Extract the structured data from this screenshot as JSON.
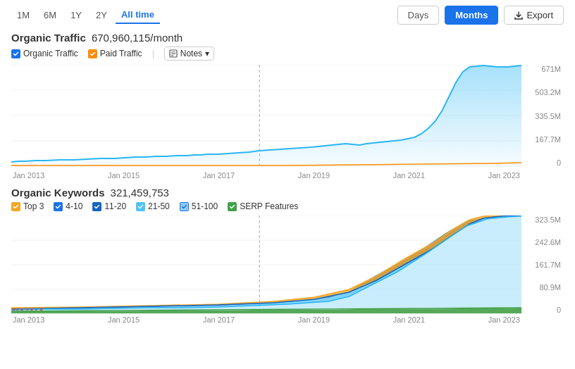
{
  "timeRange": {
    "options": [
      "1M",
      "6M",
      "1Y",
      "2Y",
      "All time"
    ],
    "active": "All time",
    "days_label": "Days",
    "months_label": "Months",
    "export_label": "Export"
  },
  "organicTraffic": {
    "title": "Organic Traffic",
    "value": "670,960,115/month",
    "legend": [
      {
        "label": "Organic Traffic",
        "color": "blue",
        "checked": true
      },
      {
        "label": "Paid Traffic",
        "color": "orange",
        "checked": true
      }
    ],
    "notes_label": "Notes",
    "yAxis": [
      "671M",
      "503.2M",
      "335.5M",
      "167.7M",
      "0"
    ],
    "xAxis": [
      "Jan 2013",
      "Jan 2015",
      "Jan 2017",
      "Jan 2019",
      "Jan 2021",
      "Jan 2023"
    ]
  },
  "organicKeywords": {
    "title": "Organic Keywords",
    "value": "321,459,753",
    "legend": [
      {
        "label": "Top 3",
        "color": "yellow"
      },
      {
        "label": "4-10",
        "color": "blue"
      },
      {
        "label": "11-20",
        "color": "darkblue"
      },
      {
        "label": "21-50",
        "color": "lightblue"
      },
      {
        "label": "51-100",
        "color": "skyblue"
      },
      {
        "label": "SERP Features",
        "color": "green"
      }
    ],
    "yAxis": [
      "323.5M",
      "242.6M",
      "161.7M",
      "80.9M",
      "0"
    ],
    "xAxis": [
      "Jan 2013",
      "Jan 2015",
      "Jan 2017",
      "Jan 2019",
      "Jan 2021",
      "Jan 2023"
    ]
  }
}
